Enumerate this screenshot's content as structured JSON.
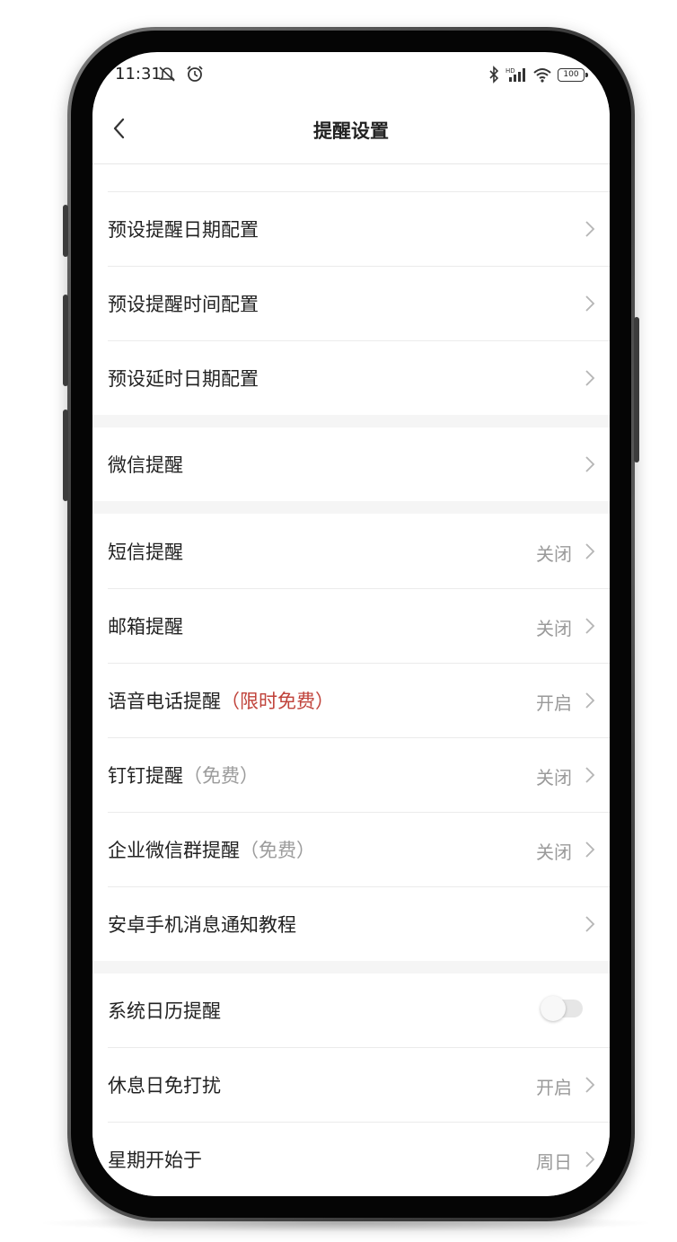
{
  "status_bar": {
    "time": "11:31",
    "battery": "100",
    "icons": [
      "mute-icon",
      "alarm-icon",
      "bluetooth-icon",
      "signal-icon",
      "wifi-icon",
      "battery-icon"
    ]
  },
  "header": {
    "title": "提醒设置",
    "back_icon": "chevron-left-icon"
  },
  "settings": {
    "date_config": "预设提醒日期配置",
    "time_config": "预设提醒时间配置",
    "delay_config": "预设延时日期配置",
    "wechat": "微信提醒",
    "sms": {
      "label": "短信提醒",
      "value": "关闭"
    },
    "email": {
      "label": "邮箱提醒",
      "value": "关闭"
    },
    "voice": {
      "label": "语音电话提醒",
      "tag": "（限时免费）",
      "value": "开启"
    },
    "dingtalk": {
      "label": "钉钉提醒",
      "tag": "（免费）",
      "value": "关闭"
    },
    "wecom": {
      "label": "企业微信群提醒",
      "tag": "（免费）",
      "value": "关闭"
    },
    "android_tutorial": "安卓手机消息通知教程",
    "calendar": {
      "label": "系统日历提醒",
      "enabled": false
    },
    "rest_day": {
      "label": "休息日免打扰",
      "value": "开启"
    },
    "week_start": {
      "label": "星期开始于",
      "value": "周日"
    }
  },
  "colors": {
    "accent_red": "#c0423a",
    "secondary_text": "#9a9a9a",
    "section_gap": "#f5f5f5"
  }
}
